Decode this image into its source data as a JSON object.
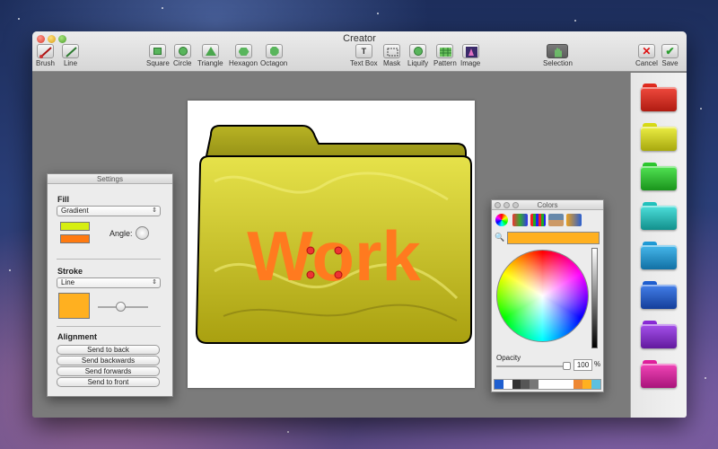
{
  "window": {
    "title": "Creator"
  },
  "toolbar": {
    "brush": "Brush",
    "line": "Line",
    "square": "Square",
    "circle": "Circle",
    "triangle": "Triangle",
    "hexagon": "Hexagon",
    "octagon": "Octagon",
    "textbox": "Text Box",
    "mask": "Mask",
    "liquify": "Liquify",
    "pattern": "Pattern",
    "image": "Image",
    "selection": "Selection",
    "cancel": "Cancel",
    "save": "Save"
  },
  "canvas": {
    "folder_text": "Work",
    "folder_color": "#c9c020",
    "text_color": "#ff7a1f"
  },
  "settings": {
    "title": "Settings",
    "fill_label": "Fill",
    "fill_type": "Gradient",
    "fill_color_1": "#d6ee10",
    "fill_color_2": "#ff7a10",
    "angle_label": "Angle:",
    "stroke_label": "Stroke",
    "stroke_type": "Line",
    "stroke_color": "#ffb020",
    "alignment_label": "Alignment",
    "send_to_back": "Send to back",
    "send_backwards": "Send backwards",
    "send_forwards": "Send forwards",
    "send_to_front": "Send to front"
  },
  "colors": {
    "title": "Colors",
    "current_color": "#ffb020",
    "opacity_label": "Opacity",
    "opacity_value": "100",
    "percent": "%"
  },
  "folders": [
    {
      "name": "red",
      "color": "#e02a1e"
    },
    {
      "name": "yellow",
      "color": "#d7da15"
    },
    {
      "name": "green",
      "color": "#2cc72e"
    },
    {
      "name": "teal",
      "color": "#22c2bd"
    },
    {
      "name": "blue",
      "color": "#1f9ad6"
    },
    {
      "name": "darkblue",
      "color": "#1e5ed0"
    },
    {
      "name": "purple",
      "color": "#8a2bd6"
    },
    {
      "name": "pink",
      "color": "#e01f9c"
    }
  ]
}
